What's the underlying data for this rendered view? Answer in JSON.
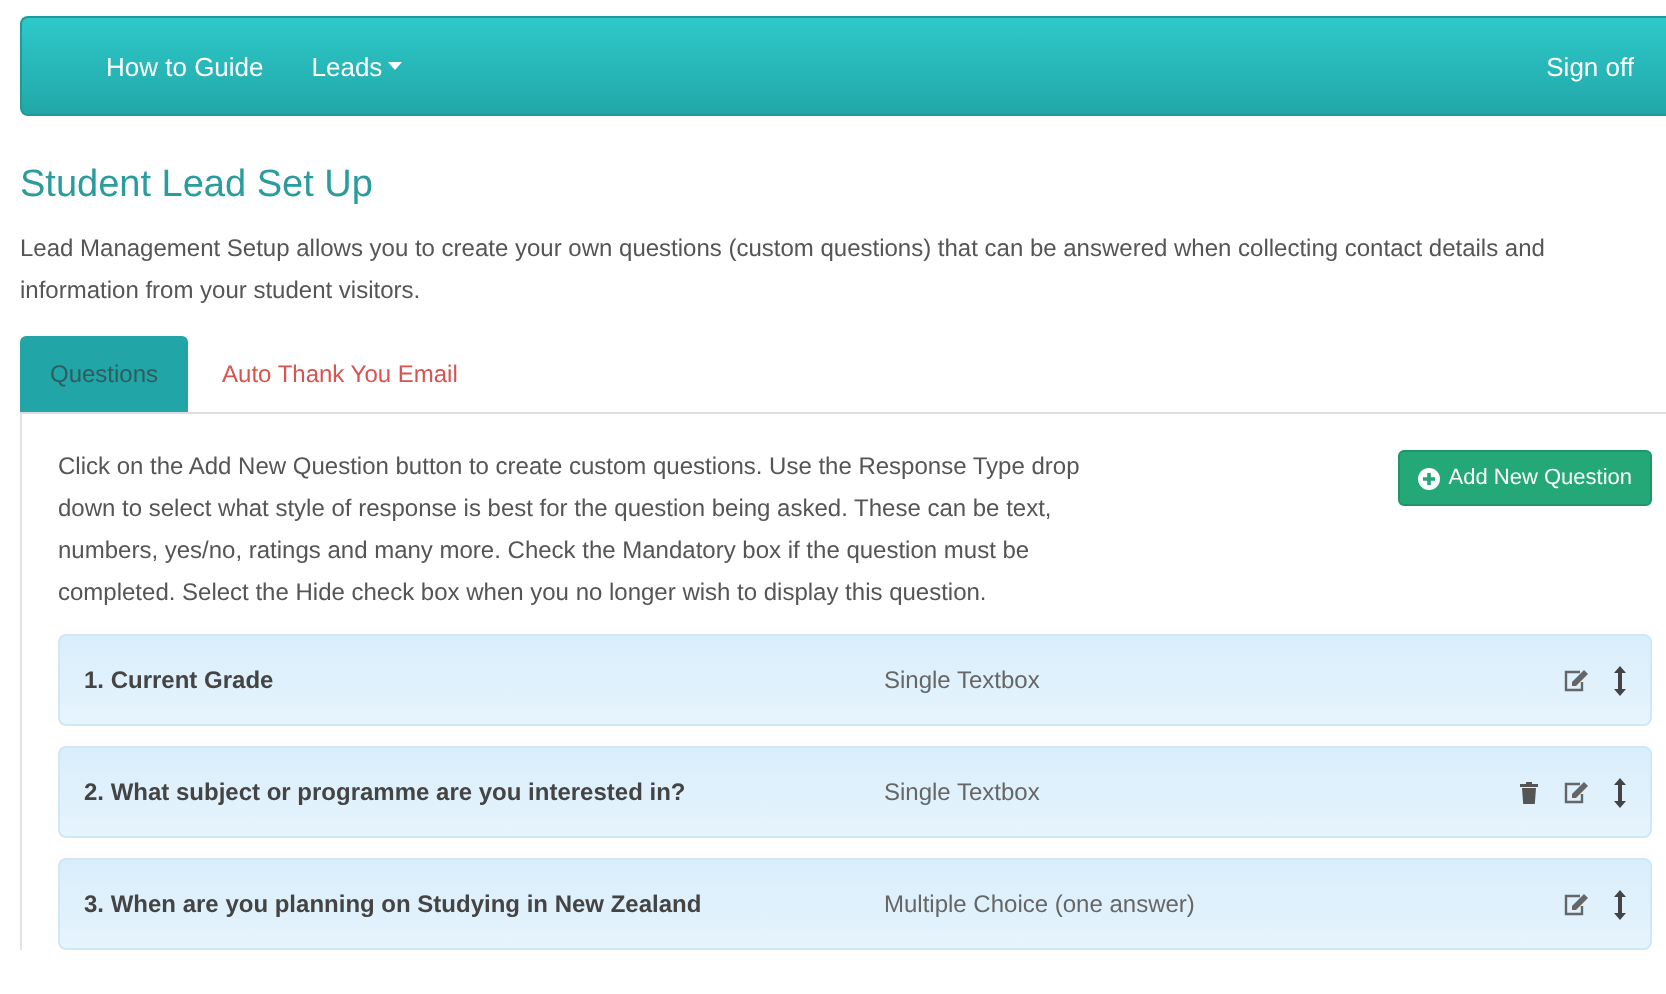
{
  "navbar": {
    "links": [
      {
        "label": "How to Guide",
        "dropdown": false
      },
      {
        "label": "Leads",
        "dropdown": true
      }
    ],
    "sign_off": "Sign off"
  },
  "page_title": "Student Lead Set Up",
  "intro": "Lead Management Setup allows you to create your own questions (custom questions) that can be answered when collecting contact details and information from your student visitors.",
  "tabs": [
    {
      "label": "Questions",
      "selected": true
    },
    {
      "label": "Auto Thank You Email",
      "selected": false
    }
  ],
  "instructions": "Click on the Add New Question button to create custom questions. Use the Response Type drop down to select what style of response is best for the question being asked. These can be text, numbers, yes/no, ratings and many more. Check the Mandatory box if the question must be completed. Select the Hide check box when you no longer wish to display this question.",
  "add_button": "Add New Question",
  "questions": [
    {
      "question": "1. Current Grade",
      "response_type": "Single Textbox",
      "deletable": false
    },
    {
      "question": "2. What subject or programme are you interested in?",
      "response_type": "Single Textbox",
      "deletable": true
    },
    {
      "question": "3. When are you planning on Studying in New Zealand",
      "response_type": "Multiple Choice (one answer)",
      "deletable": false
    }
  ]
}
